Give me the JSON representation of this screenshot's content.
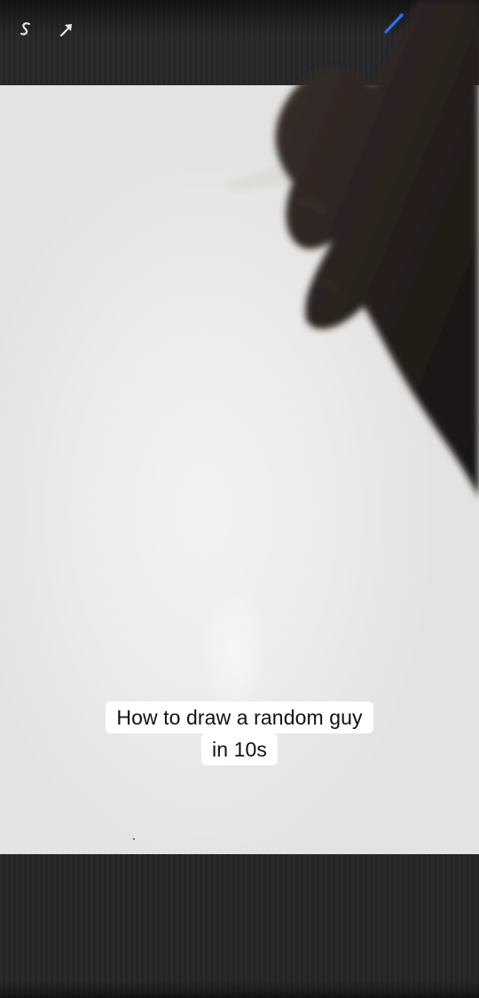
{
  "caption": {
    "line1": "How to draw a random guy",
    "line2": "in 10s"
  },
  "toolbar": {
    "icons": [
      "smudge-s-icon",
      "move-arrow-icon",
      "brush-icon"
    ]
  },
  "colors": {
    "canvas": "#eeedeb",
    "frame": "#2a2a2c",
    "brush_accent": "#2f6cf0",
    "caption_bg": "#ffffff",
    "caption_text": "#111111"
  }
}
